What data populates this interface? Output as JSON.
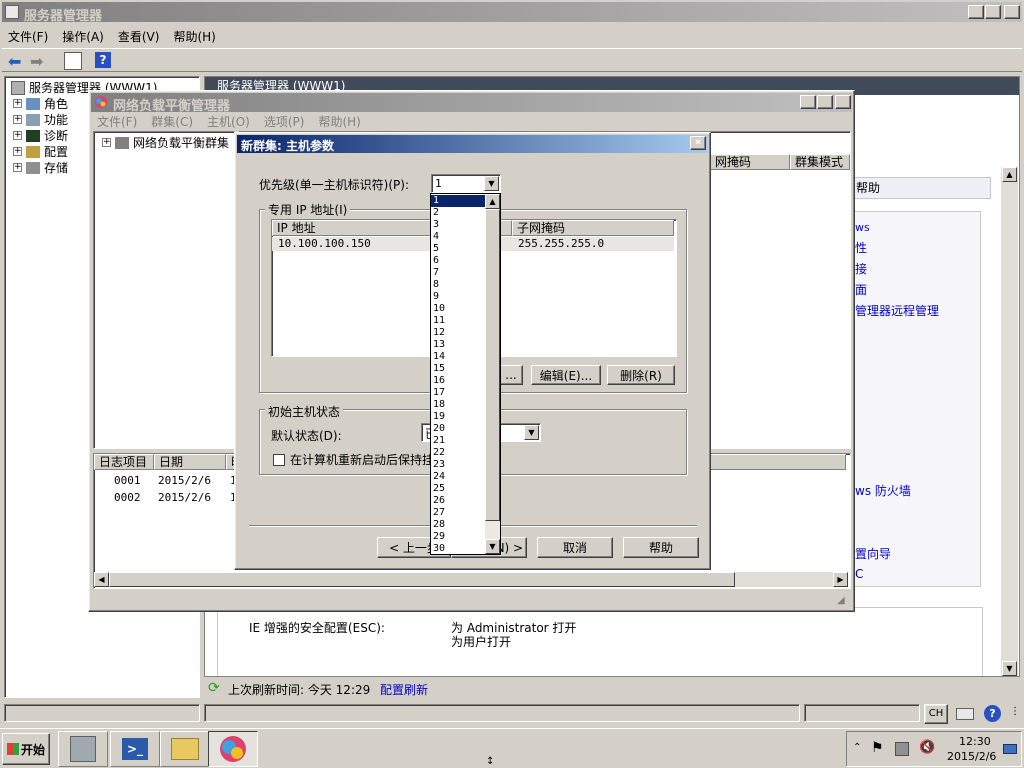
{
  "server_manager": {
    "title": "服务器管理器",
    "menu": [
      "文件(F)",
      "操作(A)",
      "查看(V)",
      "帮助(H)"
    ],
    "tree_root": "服务器管理器 (WWW1)",
    "tree_items": [
      "角色",
      "功能",
      "诊断",
      "配置",
      "存储"
    ],
    "right_header": "服务器管理器 (WWW1)",
    "help_label": "帮助",
    "side_links": [
      "ws",
      "性",
      "接",
      "面",
      "管理器远程管理",
      "ws 防火墙",
      "置向导",
      "C"
    ],
    "esc_label": "IE 增强的安全配置(ESC):",
    "esc_value1": "为 Administrator 打开",
    "esc_value2": "为用户打开",
    "refresh_label": "上次刷新时间: 今天 12:29",
    "refresh_link": "配置刷新",
    "status_ch": "CH"
  },
  "nlb_manager": {
    "title": "网络负载平衡管理器",
    "menu": [
      "文件(F)",
      "群集(C)",
      "主机(O)",
      "选项(P)",
      "帮助(H)"
    ],
    "tree_root": "网络负载平衡群集",
    "col_headers": [
      "网掩码",
      "群集模式"
    ],
    "log_headers": [
      "日志项目",
      "日期",
      "时"
    ],
    "log_rows": [
      {
        "id": "0001",
        "date": "2015/2/6",
        "time": "1"
      },
      {
        "id": "0002",
        "date": "2015/2/6",
        "time": "1"
      }
    ]
  },
  "dialog": {
    "title": "新群集: 主机参数",
    "priority_label": "优先级(单一主机标识符)(P):",
    "priority_value": "1",
    "dedicated_ip_group": "专用 IP 地址(I)",
    "ip_col": "IP 地址",
    "mask_col": "子网掩码",
    "ip_value": "10.100.100.150",
    "mask_value": "255.255.255.0",
    "add_button": "...",
    "edit_button": "编辑(E)...",
    "delete_button": "删除(R)",
    "initial_state_group": "初始主机状态",
    "default_state_label": "默认状态(D):",
    "default_state_value": "已",
    "persist_checkbox": "在计算机重新启动后保持挂",
    "back_button": "< 上一步",
    "next_button": "下一步(N) >",
    "cancel_button": "取消",
    "help_button": "帮助",
    "dropdown_options": [
      "1",
      "2",
      "3",
      "4",
      "5",
      "6",
      "7",
      "8",
      "9",
      "10",
      "11",
      "12",
      "13",
      "14",
      "15",
      "16",
      "17",
      "18",
      "19",
      "20",
      "21",
      "22",
      "23",
      "24",
      "25",
      "26",
      "27",
      "28",
      "29",
      "30"
    ]
  },
  "taskbar": {
    "start_label": "开始",
    "time": "12:30",
    "date": "2015/2/6"
  }
}
